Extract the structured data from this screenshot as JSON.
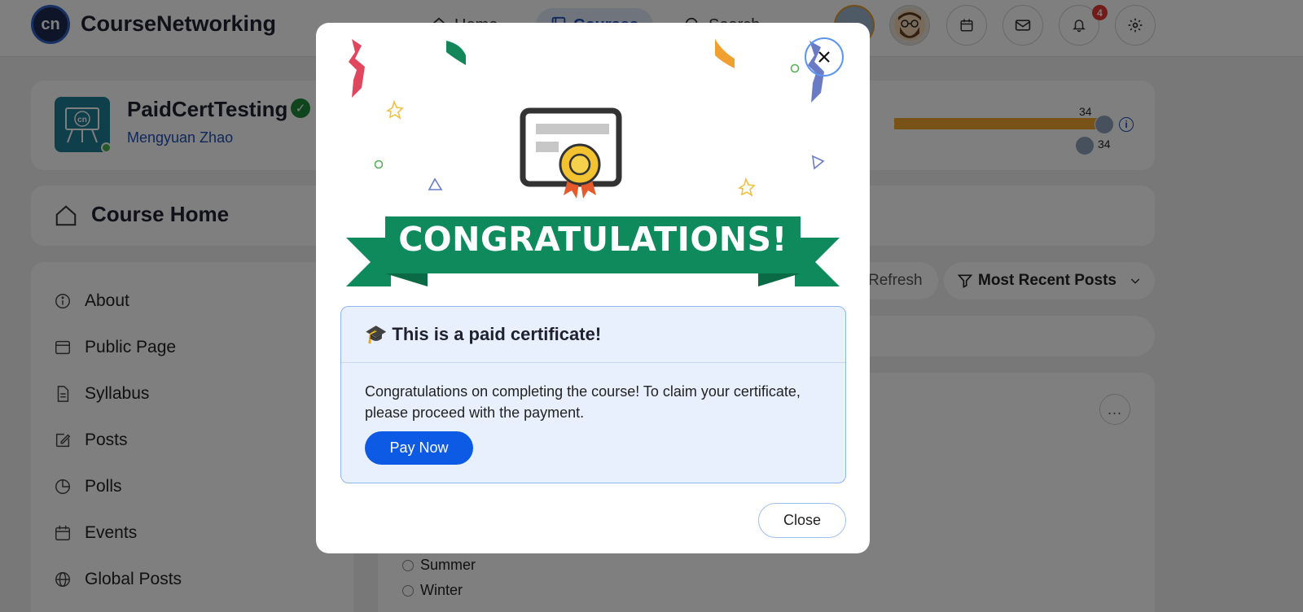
{
  "header": {
    "brand_logo": "cn",
    "brand": "CourseNetworking",
    "nav": {
      "home": "Home",
      "courses": "Courses",
      "search": "Search"
    },
    "notification_count": "4",
    "icons": [
      "calendar-icon",
      "mail-icon",
      "bell-icon",
      "gear-icon"
    ]
  },
  "course": {
    "logo_text": "cn",
    "title": "PaidCertTesting",
    "instructor": "Mengyuan Zhao",
    "progress_top": "34",
    "progress_bottom": "34",
    "progress_color": "#f2a531"
  },
  "course_home": {
    "title": "Course Home"
  },
  "sidebar": {
    "items": [
      {
        "label": "About",
        "icon": "info-icon"
      },
      {
        "label": "Public Page",
        "icon": "browser-icon"
      },
      {
        "label": "Syllabus",
        "icon": "document-icon"
      },
      {
        "label": "Posts",
        "icon": "edit-icon"
      },
      {
        "label": "Polls",
        "icon": "pie-chart-icon"
      },
      {
        "label": "Events",
        "icon": "calendar-icon"
      },
      {
        "label": "Global Posts",
        "icon": "globe-icon"
      }
    ]
  },
  "feed": {
    "refresh": "Refresh",
    "sort": "Most Recent Posts",
    "more": "...",
    "options": [
      "Summer",
      "Winter"
    ]
  },
  "modal": {
    "banner": "CONGRATULATIONS!",
    "alert_icon": "🎓",
    "alert_title": "This is a paid certificate!",
    "alert_text": "Congratulations on completing the course! To claim your certificate, please proceed with the payment.",
    "pay_button": "Pay Now",
    "close_button": "Close",
    "colors": {
      "banner_green": "#0f8a5c",
      "pay_blue": "#0d5be5"
    }
  }
}
